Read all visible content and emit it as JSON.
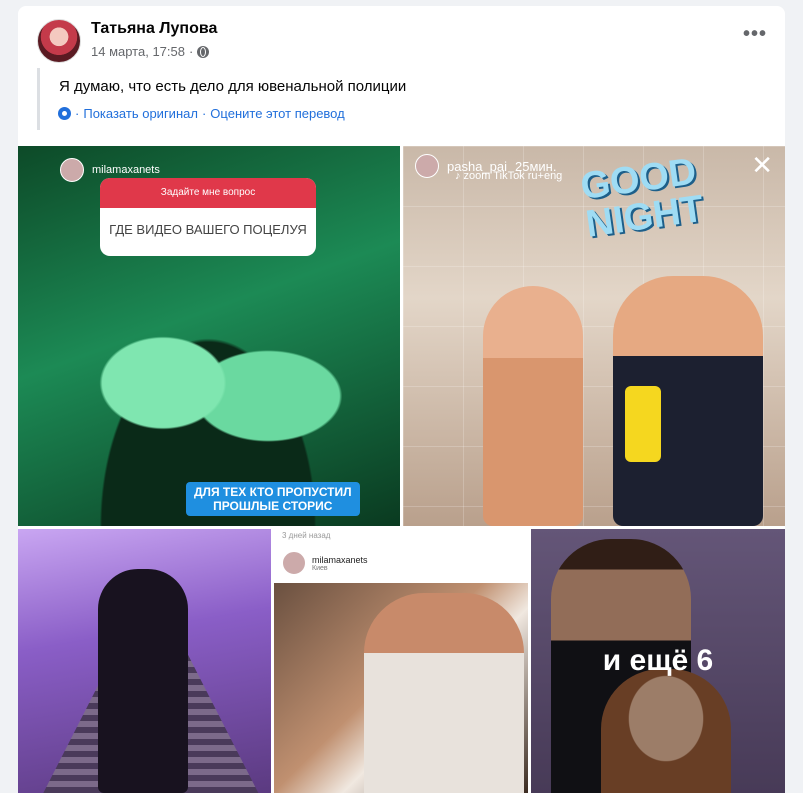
{
  "post": {
    "author": "Татьяна Лупова",
    "date": "14 марта, 17:58",
    "separator": "·",
    "text": "Я думаю, что есть дело для ювенальной полиции",
    "translation": {
      "show_original": "Показать оригинал",
      "dot": "·",
      "rate": "Оцените этот перевод"
    },
    "more_icon": "more-options-icon"
  },
  "photos": {
    "p1": {
      "username": "milamaxanets",
      "question_prompt": "Задайте мне вопрос",
      "question": "ГДЕ ВИДЕО ВАШЕГО ПОЦЕЛУЯ",
      "caption_line1": "ДЛЯ ТЕХ КТО ПРОПУСТИЛ",
      "caption_line2": "ПРОШЛЫЕ СТОРИС"
    },
    "p2": {
      "username": "pasha_pai",
      "time": "25мин.",
      "music": "♪ zoom TikTok ru+eng",
      "sticker_line1": "GOOD",
      "sticker_line2": "NIGHT",
      "close": "✕"
    },
    "p4": {
      "days": "3 дней назад",
      "username": "milamaxanets",
      "location": "Киев"
    },
    "p5": {
      "more_label": "и ещё 6"
    }
  }
}
